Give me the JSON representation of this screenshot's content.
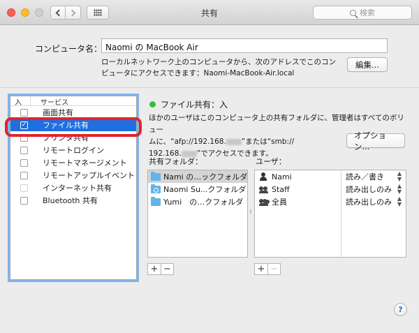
{
  "window": {
    "title": "共有",
    "search_placeholder": "検索"
  },
  "computer": {
    "label": "コンピュータ名：",
    "name": "Naomi の MacBook Air",
    "description": "ローカルネットワーク上のコンピュータから、次のアドレスでこのコンピュータにアクセスできます：Naomi-MacBook-Air.local",
    "edit_button": "編集..."
  },
  "services": {
    "header_on": "入",
    "header_service": "サービス",
    "items": [
      {
        "label": "画面共有",
        "checked": false
      },
      {
        "label": "ファイル共有",
        "checked": true
      },
      {
        "label": "プリンタ共有",
        "checked": false
      },
      {
        "label": "リモートログイン",
        "checked": false
      },
      {
        "label": "リモートマネージメント",
        "checked": false
      },
      {
        "label": "リモートアップルイベント",
        "checked": false
      },
      {
        "label": "インターネット共有",
        "checked": false
      },
      {
        "label": "Bluetooth 共有",
        "checked": false
      }
    ]
  },
  "detail": {
    "status": "ファイル共有：入",
    "status_color": "#33c13a",
    "desc_line1": "ほかのユーザはこのコンピュータ上の共有フォルダに、管理者はすべてのボリュー",
    "desc_line2a": "ムに、“afp://192.168.",
    "desc_line2b": "”または“smb://",
    "desc_line3a": "192.168.",
    "desc_line3b": "”でアクセスできます。",
    "options_button": "オプション..."
  },
  "folders": {
    "label": "共有フォルダ：",
    "items": [
      {
        "name": "Nami の…ックフォルダ"
      },
      {
        "name": "Naomi Su...クフォルダ"
      },
      {
        "name": "Yumi　の…クフォルダ"
      }
    ]
  },
  "users": {
    "label": "ユーザ：",
    "items": [
      {
        "name": "Nami",
        "permission": "読み／書き"
      },
      {
        "name": "Staff",
        "permission": "読み出しのみ"
      },
      {
        "name": "全員",
        "permission": "読み出しのみ"
      }
    ]
  },
  "controls": {
    "plus": "+",
    "minus": "−",
    "help": "?"
  },
  "colors": {
    "selection": "#1f6fe0",
    "annotation_ring": "#e0242e",
    "folder": "#62b4ea"
  }
}
